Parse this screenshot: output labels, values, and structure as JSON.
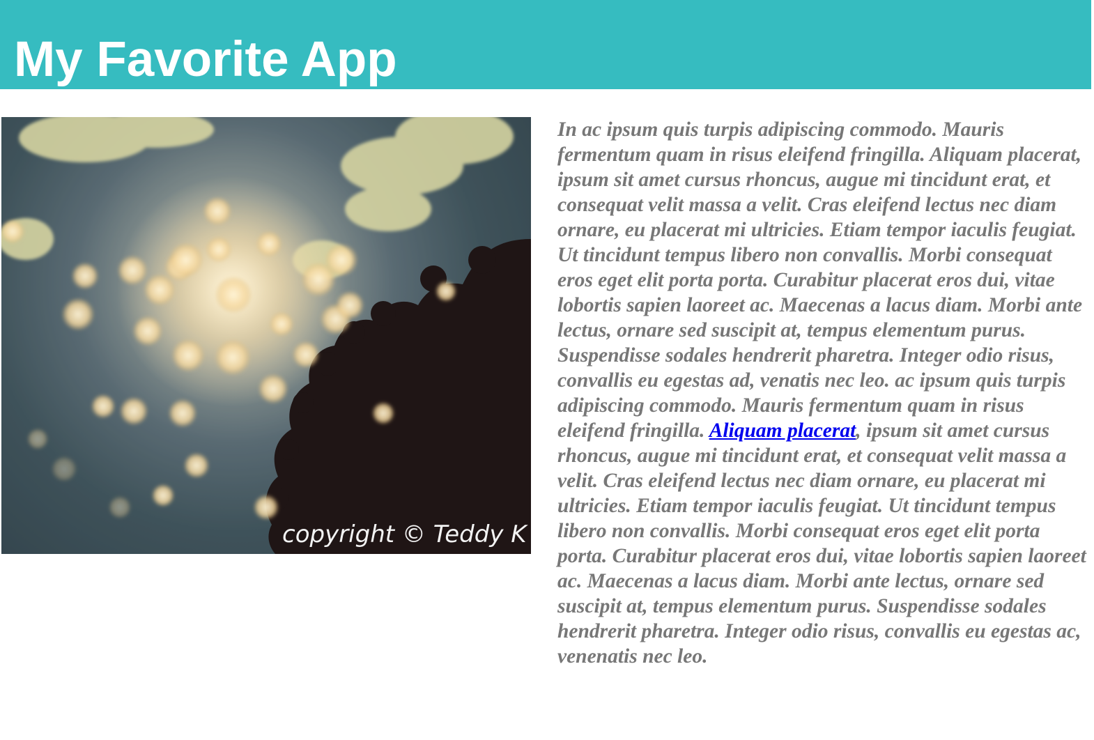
{
  "header": {
    "title": "My Favorite App",
    "background": "#36bcc0"
  },
  "photo": {
    "watermark_text": "copyright © Teddy K",
    "subject": "bokeh sunlight through tree branches"
  },
  "article": {
    "text_before_link": "In ac ipsum quis turpis adipiscing commodo. Mauris fermentum quam in risus eleifend fringilla. Aliquam placerat, ipsum sit amet cursus rhoncus, augue mi tincidunt erat, et consequat velit massa a velit. Cras eleifend lectus nec diam ornare, eu placerat mi ultricies. Etiam tempor iaculis feugiat. Ut tincidunt tempus libero non convallis. Morbi consequat eros eget elit porta porta. Curabitur placerat eros dui, vitae lobortis sapien laoreet ac. Maecenas a lacus diam. Morbi ante lectus, ornare sed suscipit at, tempus elementum purus. Suspendisse sodales hendrerit pharetra. Integer odio risus, convallis eu egestas ad, venatis nec leo. ac ipsum quis turpis adipiscing commodo. Mauris fermentum quam in risus eleifend fringilla. ",
    "link_text": "Aliquam placerat",
    "text_after_link": ", ipsum sit amet cursus rhoncus, augue mi tincidunt erat, et consequat velit massa a velit. Cras eleifend lectus nec diam ornare, eu placerat mi ultricies. Etiam tempor iaculis feugiat. Ut tincidunt tempus libero non convallis. Morbi consequat eros eget elit porta porta. Curabitur placerat eros dui, vitae lobortis sapien laoreet ac. Maecenas a lacus diam. Morbi ante lectus, ornare sed suscipit at, tempus elementum purus. Suspendisse sodales hendrerit pharetra. Integer odio risus, convallis eu egestas ac, venenatis nec leo.",
    "text_color": "#777777",
    "link_color": "#0000ee"
  }
}
